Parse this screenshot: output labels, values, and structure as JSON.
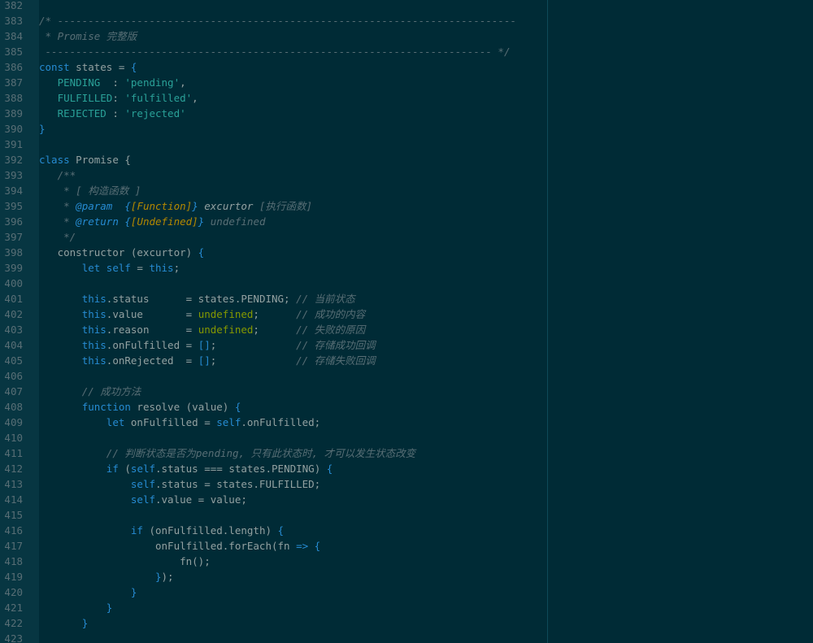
{
  "editor": {
    "colors": {
      "background": "#002b36",
      "gutter": "#073642",
      "line_number": "#586e75",
      "text": "#93a1a1",
      "comment": "#586e75",
      "keyword": "#268bd2",
      "string": "#2aa198",
      "value": "#859900",
      "type": "#b58900"
    },
    "lines": [
      {
        "n": "382",
        "tokens": []
      },
      {
        "n": "383",
        "tokens": [
          {
            "t": "comment",
            "v": "/* ---------------------------------------------------------------------------"
          }
        ]
      },
      {
        "n": "384",
        "tokens": [
          {
            "t": "comment",
            "v": " * Promise 完整版"
          }
        ]
      },
      {
        "n": "385",
        "tokens": [
          {
            "t": "comment",
            "v": " ------------------------------------------------------------------------- */"
          }
        ]
      },
      {
        "n": "386",
        "tokens": [
          {
            "t": "keyword",
            "v": "const"
          },
          {
            "t": "plain",
            "v": " states = "
          },
          {
            "t": "punct",
            "v": "{"
          }
        ]
      },
      {
        "n": "387",
        "tokens": [
          {
            "t": "plain",
            "v": "   "
          },
          {
            "t": "prop",
            "v": "PENDING"
          },
          {
            "t": "plain",
            "v": "  : "
          },
          {
            "t": "string",
            "v": "'pending'"
          },
          {
            "t": "plain",
            "v": ","
          }
        ]
      },
      {
        "n": "388",
        "tokens": [
          {
            "t": "plain",
            "v": "   "
          },
          {
            "t": "prop",
            "v": "FULFILLED"
          },
          {
            "t": "plain",
            "v": ": "
          },
          {
            "t": "string",
            "v": "'fulfilled'"
          },
          {
            "t": "plain",
            "v": ","
          }
        ]
      },
      {
        "n": "389",
        "tokens": [
          {
            "t": "plain",
            "v": "   "
          },
          {
            "t": "prop",
            "v": "REJECTED"
          },
          {
            "t": "plain",
            "v": " : "
          },
          {
            "t": "string",
            "v": "'rejected'"
          }
        ]
      },
      {
        "n": "390",
        "tokens": [
          {
            "t": "punct",
            "v": "}"
          }
        ]
      },
      {
        "n": "391",
        "tokens": []
      },
      {
        "n": "392",
        "tokens": [
          {
            "t": "keyword",
            "v": "class"
          },
          {
            "t": "plain",
            "v": " Promise {"
          }
        ]
      },
      {
        "n": "393",
        "tokens": [
          {
            "t": "plain",
            "v": "   "
          },
          {
            "t": "comment",
            "v": "/**"
          }
        ]
      },
      {
        "n": "394",
        "tokens": [
          {
            "t": "plain",
            "v": "    "
          },
          {
            "t": "comment",
            "v": "* [ 构造函数 ]"
          }
        ]
      },
      {
        "n": "395",
        "tokens": [
          {
            "t": "plain",
            "v": "    "
          },
          {
            "t": "comment",
            "v": "* "
          },
          {
            "t": "doctag",
            "v": "@param"
          },
          {
            "t": "comment",
            "v": "  "
          },
          {
            "t": "doctag",
            "v": "{"
          },
          {
            "t": "doctype",
            "v": "[Function]"
          },
          {
            "t": "doctag",
            "v": "}"
          },
          {
            "t": "docname",
            "v": " excurtor"
          },
          {
            "t": "docmeta",
            "v": " [执行函数]"
          }
        ]
      },
      {
        "n": "396",
        "tokens": [
          {
            "t": "plain",
            "v": "    "
          },
          {
            "t": "comment",
            "v": "* "
          },
          {
            "t": "doctag",
            "v": "@return"
          },
          {
            "t": "comment",
            "v": " "
          },
          {
            "t": "doctag",
            "v": "{"
          },
          {
            "t": "doctype",
            "v": "[Undefined]"
          },
          {
            "t": "doctag",
            "v": "}"
          },
          {
            "t": "docmeta",
            "v": " undefined"
          }
        ]
      },
      {
        "n": "397",
        "tokens": [
          {
            "t": "plain",
            "v": "    "
          },
          {
            "t": "comment",
            "v": "*/"
          }
        ]
      },
      {
        "n": "398",
        "tokens": [
          {
            "t": "plain",
            "v": "   constructor (excurtor) "
          },
          {
            "t": "punct",
            "v": "{"
          }
        ]
      },
      {
        "n": "399",
        "tokens": [
          {
            "t": "plain",
            "v": "       "
          },
          {
            "t": "keyword",
            "v": "let"
          },
          {
            "t": "plain",
            "v": " "
          },
          {
            "t": "keyword",
            "v": "self"
          },
          {
            "t": "plain",
            "v": " = "
          },
          {
            "t": "keyword",
            "v": "this"
          },
          {
            "t": "plain",
            "v": ";"
          }
        ]
      },
      {
        "n": "400",
        "tokens": []
      },
      {
        "n": "401",
        "tokens": [
          {
            "t": "plain",
            "v": "       "
          },
          {
            "t": "keyword",
            "v": "this"
          },
          {
            "t": "plain",
            "v": ".status      = states.PENDING; "
          },
          {
            "t": "comment",
            "v": "// 当前状态"
          }
        ]
      },
      {
        "n": "402",
        "tokens": [
          {
            "t": "plain",
            "v": "       "
          },
          {
            "t": "keyword",
            "v": "this"
          },
          {
            "t": "plain",
            "v": ".value       = "
          },
          {
            "t": "value",
            "v": "undefined"
          },
          {
            "t": "plain",
            "v": ";      "
          },
          {
            "t": "comment",
            "v": "// 成功的内容"
          }
        ]
      },
      {
        "n": "403",
        "tokens": [
          {
            "t": "plain",
            "v": "       "
          },
          {
            "t": "keyword",
            "v": "this"
          },
          {
            "t": "plain",
            "v": ".reason      = "
          },
          {
            "t": "value",
            "v": "undefined"
          },
          {
            "t": "plain",
            "v": ";      "
          },
          {
            "t": "comment",
            "v": "// 失败的原因"
          }
        ]
      },
      {
        "n": "404",
        "tokens": [
          {
            "t": "plain",
            "v": "       "
          },
          {
            "t": "keyword",
            "v": "this"
          },
          {
            "t": "plain",
            "v": ".onFulfilled = "
          },
          {
            "t": "punct",
            "v": "[]"
          },
          {
            "t": "plain",
            "v": ";             "
          },
          {
            "t": "comment",
            "v": "// 存储成功回调"
          }
        ]
      },
      {
        "n": "405",
        "tokens": [
          {
            "t": "plain",
            "v": "       "
          },
          {
            "t": "keyword",
            "v": "this"
          },
          {
            "t": "plain",
            "v": ".onRejected  = "
          },
          {
            "t": "punct",
            "v": "[]"
          },
          {
            "t": "plain",
            "v": ";             "
          },
          {
            "t": "comment",
            "v": "// 存储失败回调"
          }
        ]
      },
      {
        "n": "406",
        "tokens": []
      },
      {
        "n": "407",
        "tokens": [
          {
            "t": "plain",
            "v": "       "
          },
          {
            "t": "comment",
            "v": "// 成功方法"
          }
        ]
      },
      {
        "n": "408",
        "tokens": [
          {
            "t": "plain",
            "v": "       "
          },
          {
            "t": "keyword",
            "v": "function"
          },
          {
            "t": "plain",
            "v": " resolve (value) "
          },
          {
            "t": "punct",
            "v": "{"
          }
        ]
      },
      {
        "n": "409",
        "tokens": [
          {
            "t": "plain",
            "v": "           "
          },
          {
            "t": "keyword",
            "v": "let"
          },
          {
            "t": "plain",
            "v": " onFulfilled = "
          },
          {
            "t": "keyword",
            "v": "self"
          },
          {
            "t": "plain",
            "v": ".onFulfilled;"
          }
        ]
      },
      {
        "n": "410",
        "tokens": []
      },
      {
        "n": "411",
        "tokens": [
          {
            "t": "plain",
            "v": "           "
          },
          {
            "t": "comment",
            "v": "// 判断状态是否为pending, 只有此状态时, 才可以发生状态改变"
          }
        ]
      },
      {
        "n": "412",
        "tokens": [
          {
            "t": "plain",
            "v": "           "
          },
          {
            "t": "keyword",
            "v": "if"
          },
          {
            "t": "plain",
            "v": " ("
          },
          {
            "t": "keyword",
            "v": "self"
          },
          {
            "t": "plain",
            "v": ".status === states.PENDING) "
          },
          {
            "t": "punct",
            "v": "{"
          }
        ]
      },
      {
        "n": "413",
        "tokens": [
          {
            "t": "plain",
            "v": "               "
          },
          {
            "t": "keyword",
            "v": "self"
          },
          {
            "t": "plain",
            "v": ".status = states.FULFILLED;"
          }
        ]
      },
      {
        "n": "414",
        "tokens": [
          {
            "t": "plain",
            "v": "               "
          },
          {
            "t": "keyword",
            "v": "self"
          },
          {
            "t": "plain",
            "v": ".value = value;"
          }
        ]
      },
      {
        "n": "415",
        "tokens": []
      },
      {
        "n": "416",
        "tokens": [
          {
            "t": "plain",
            "v": "               "
          },
          {
            "t": "keyword",
            "v": "if"
          },
          {
            "t": "plain",
            "v": " (onFulfilled.length) "
          },
          {
            "t": "punct",
            "v": "{"
          }
        ]
      },
      {
        "n": "417",
        "tokens": [
          {
            "t": "plain",
            "v": "                   onFulfilled.forEach(fn "
          },
          {
            "t": "keyword",
            "v": "=>"
          },
          {
            "t": "plain",
            "v": " "
          },
          {
            "t": "punct",
            "v": "{"
          }
        ]
      },
      {
        "n": "418",
        "tokens": [
          {
            "t": "plain",
            "v": "                       fn();"
          }
        ]
      },
      {
        "n": "419",
        "tokens": [
          {
            "t": "plain",
            "v": "                   "
          },
          {
            "t": "punct",
            "v": "}"
          },
          {
            "t": "plain",
            "v": ");"
          }
        ]
      },
      {
        "n": "420",
        "tokens": [
          {
            "t": "plain",
            "v": "               "
          },
          {
            "t": "punct",
            "v": "}"
          }
        ]
      },
      {
        "n": "421",
        "tokens": [
          {
            "t": "plain",
            "v": "           "
          },
          {
            "t": "punct",
            "v": "}"
          }
        ]
      },
      {
        "n": "422",
        "tokens": [
          {
            "t": "plain",
            "v": "       "
          },
          {
            "t": "punct",
            "v": "}"
          }
        ]
      },
      {
        "n": "423",
        "tokens": []
      }
    ]
  }
}
